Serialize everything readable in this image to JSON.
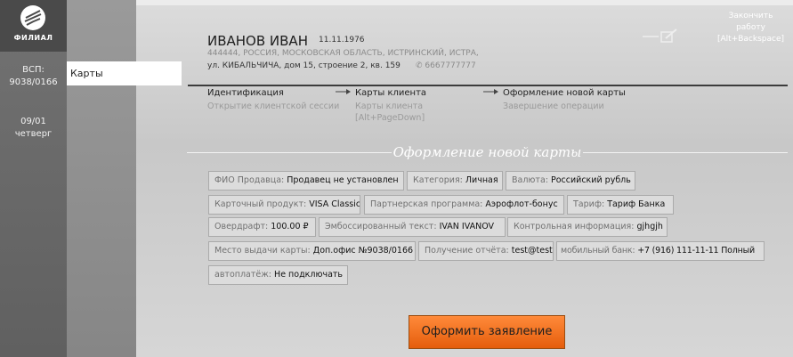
{
  "rail": {
    "logo_text": "ФИЛИАЛ",
    "vsp_line1": "ВСП:",
    "vsp_line2": "9038/0166",
    "date_line1": "09/01",
    "date_line2": "четверг"
  },
  "menu": {
    "active_item": "Карты"
  },
  "client": {
    "name": "ИВАНОВ ИВАН",
    "dob": "11.11.1976",
    "address_line1": "444444, РОССИЯ, МОСКОВСКАЯ ОБЛАСТЬ, ИСТРИНСКИЙ, ИСТРА,",
    "address_line2": "ул. КИБАЛЬЧИЧА, дом 15, строение 2, кв. 159",
    "phone": "6667777777"
  },
  "finish": {
    "line1": "Закончить",
    "line2": "работу",
    "line3": "[Alt+Backspace]"
  },
  "steps": [
    {
      "title": "Идентификация",
      "sub1": "Открытие клиентской сессии",
      "sub2": ""
    },
    {
      "title": "Карты клиента",
      "sub1": "Карты клиента",
      "sub2": "[Alt+PageDown]"
    },
    {
      "title": "Оформление новой карты",
      "sub1": "Завершение операции",
      "sub2": ""
    }
  ],
  "section_title": "Оформление новой карты",
  "fields": [
    {
      "key": "ФИО Продавца:",
      "value": "Продавец не установлен"
    },
    {
      "key": "Категория:",
      "value": "Личная"
    },
    {
      "key": "Валюта:",
      "value": "Российский рубль"
    },
    {
      "key": "Карточный продукт:",
      "value": "VISA Classic"
    },
    {
      "key": "Партнерская программа:",
      "value": "Аэрофлот-бонус"
    },
    {
      "key": "Тариф:",
      "value": "Тариф Банка"
    },
    {
      "key": "Овердрафт:",
      "value": "100.00 ₽"
    },
    {
      "key": "Эмбоссированный текст:",
      "value": "IVAN IVANOV"
    },
    {
      "key": "Контрольная информация:",
      "value": "gjhgjh"
    },
    {
      "key": "Место выдачи карты:",
      "value": "Доп.офис №9038/0166"
    },
    {
      "key": "Получение отчёта:",
      "value": "test@test"
    },
    {
      "key": "мобильный банк:",
      "value": "+7 (916) 111-11-11 Полный"
    },
    {
      "key": "автоплатёж:",
      "value": "Не подключать"
    }
  ],
  "submit_label": "Оформить заявление",
  "colors": {
    "accent": "#f07020",
    "rail": "#6a6a6a"
  }
}
